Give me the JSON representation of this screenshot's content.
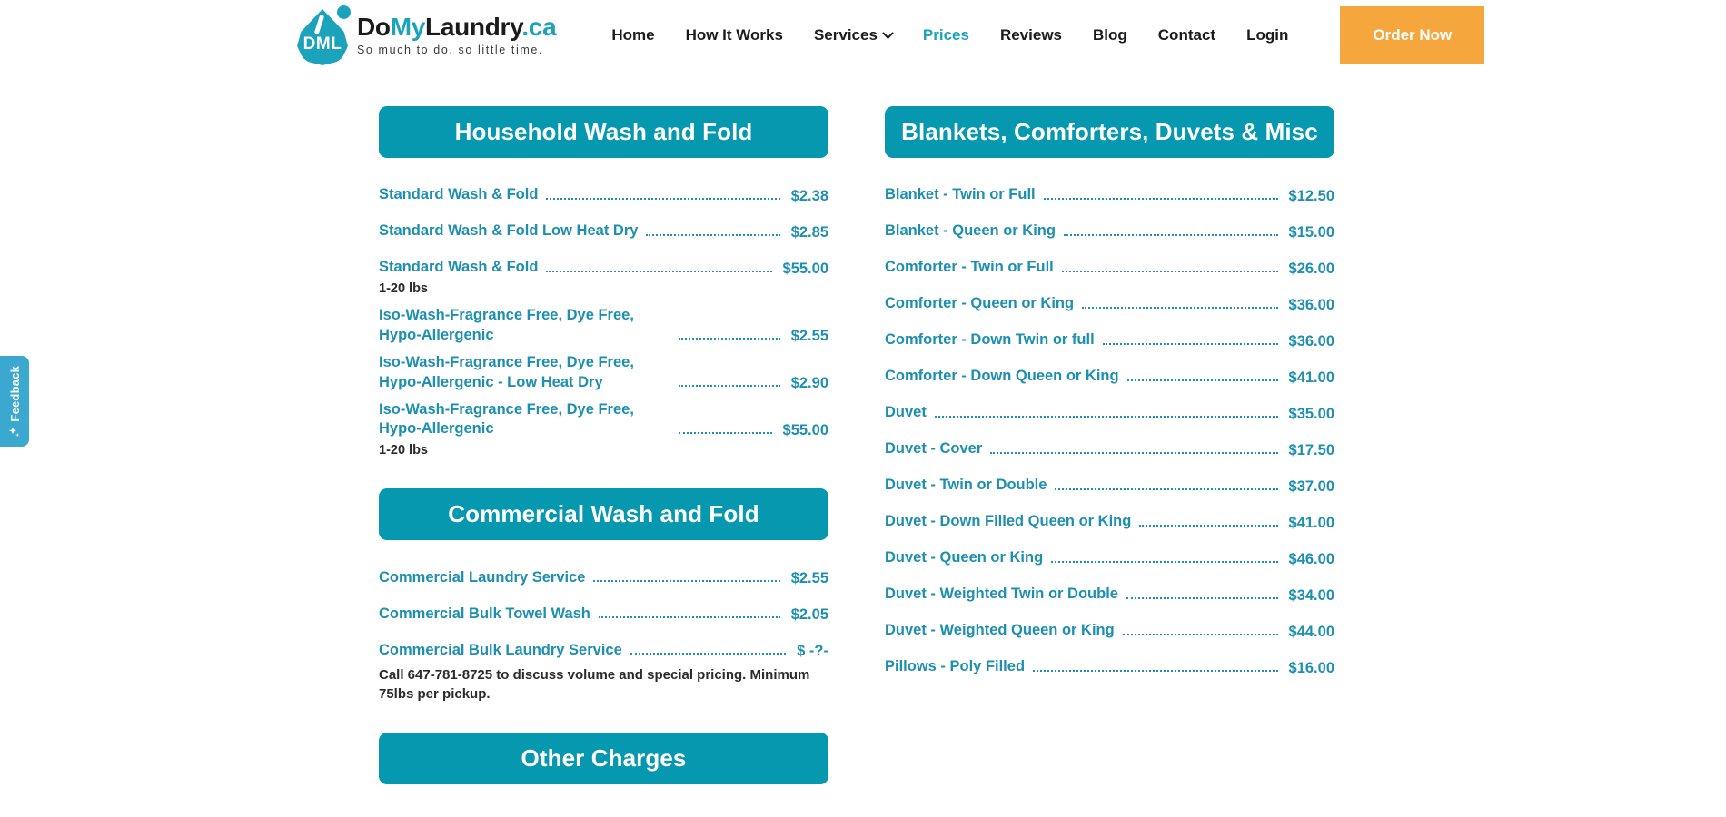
{
  "header": {
    "logo": {
      "mark_text": "DML",
      "name_part1": "Do",
      "name_part2": "My",
      "name_part3": "Laundry",
      "name_part4": ".ca",
      "tagline": "So much to do. so little time."
    },
    "nav": [
      {
        "label": "Home",
        "active": false,
        "has_chevron": false
      },
      {
        "label": "How It Works",
        "active": false,
        "has_chevron": false
      },
      {
        "label": "Services",
        "active": false,
        "has_chevron": true
      },
      {
        "label": "Prices",
        "active": true,
        "has_chevron": false
      },
      {
        "label": "Reviews",
        "active": false,
        "has_chevron": false
      },
      {
        "label": "Blog",
        "active": false,
        "has_chevron": false
      },
      {
        "label": "Contact",
        "active": false,
        "has_chevron": false
      },
      {
        "label": "Login",
        "active": false,
        "has_chevron": false
      }
    ],
    "order_button_label": "Order Now"
  },
  "feedback_tab": {
    "label": "Feedback",
    "icon": "sparkle-icon"
  },
  "colors": {
    "teal_header": "#0598AE",
    "teal_text": "#1D8FB0",
    "logo_teal": "#1AA3BA",
    "orange_button": "#F5A63C",
    "feedback_blue": "#3BA8CF",
    "note_text": "#2b2b2b"
  },
  "left_column": {
    "sections": [
      {
        "title": "Household Wash and Fold",
        "items": [
          {
            "name": "Standard Wash & Fold",
            "price": "$2.38",
            "note": ""
          },
          {
            "name": "Standard Wash & Fold Low Heat Dry",
            "price": "$2.85",
            "note": ""
          },
          {
            "name": "Standard Wash & Fold",
            "price": "$55.00",
            "note": "1-20 lbs"
          },
          {
            "name": "Iso-Wash-Fragrance Free, Dye Free, Hypo-Allergenic",
            "price": "$2.55",
            "note": ""
          },
          {
            "name": "Iso-Wash-Fragrance Free, Dye Free, Hypo-Allergenic - Low Heat Dry",
            "price": "$2.90",
            "note": ""
          },
          {
            "name": "Iso-Wash-Fragrance Free, Dye Free, Hypo-Allergenic",
            "price": "$55.00",
            "note": "1-20 lbs"
          }
        ],
        "footnote": ""
      },
      {
        "title": "Commercial Wash and Fold",
        "items": [
          {
            "name": "Commercial Laundry Service",
            "price": "$2.55",
            "note": ""
          },
          {
            "name": "Commercial Bulk Towel Wash",
            "price": "$2.05",
            "note": ""
          },
          {
            "name": "Commercial Bulk Laundry Service",
            "price": "$ -?-",
            "note": ""
          }
        ],
        "footnote": "Call 647-781-8725 to discuss volume and special pricing. Minimum 75lbs per pickup."
      },
      {
        "title": "Other Charges",
        "items": [],
        "footnote": ""
      }
    ]
  },
  "right_column": {
    "sections": [
      {
        "title": "Blankets, Comforters, Duvets & Misc",
        "items": [
          {
            "name": "Blanket - Twin or Full",
            "price": "$12.50",
            "note": ""
          },
          {
            "name": "Blanket - Queen or King",
            "price": "$15.00",
            "note": ""
          },
          {
            "name": "Comforter - Twin or Full",
            "price": "$26.00",
            "note": ""
          },
          {
            "name": "Comforter - Queen or King",
            "price": "$36.00",
            "note": ""
          },
          {
            "name": "Comforter - Down Twin or full",
            "price": "$36.00",
            "note": ""
          },
          {
            "name": "Comforter - Down Queen or King",
            "price": "$41.00",
            "note": ""
          },
          {
            "name": "Duvet",
            "price": "$35.00",
            "note": ""
          },
          {
            "name": "Duvet - Cover",
            "price": "$17.50",
            "note": ""
          },
          {
            "name": "Duvet - Twin or Double",
            "price": "$37.00",
            "note": ""
          },
          {
            "name": "Duvet - Down Filled Queen or King",
            "price": "$41.00",
            "note": ""
          },
          {
            "name": "Duvet - Queen or King",
            "price": "$46.00",
            "note": ""
          },
          {
            "name": "Duvet - Weighted Twin or Double",
            "price": "$34.00",
            "note": ""
          },
          {
            "name": "Duvet - Weighted Queen or King",
            "price": "$44.00",
            "note": ""
          },
          {
            "name": "Pillows - Poly Filled",
            "price": "$16.00",
            "note": ""
          }
        ],
        "footnote": ""
      }
    ]
  }
}
